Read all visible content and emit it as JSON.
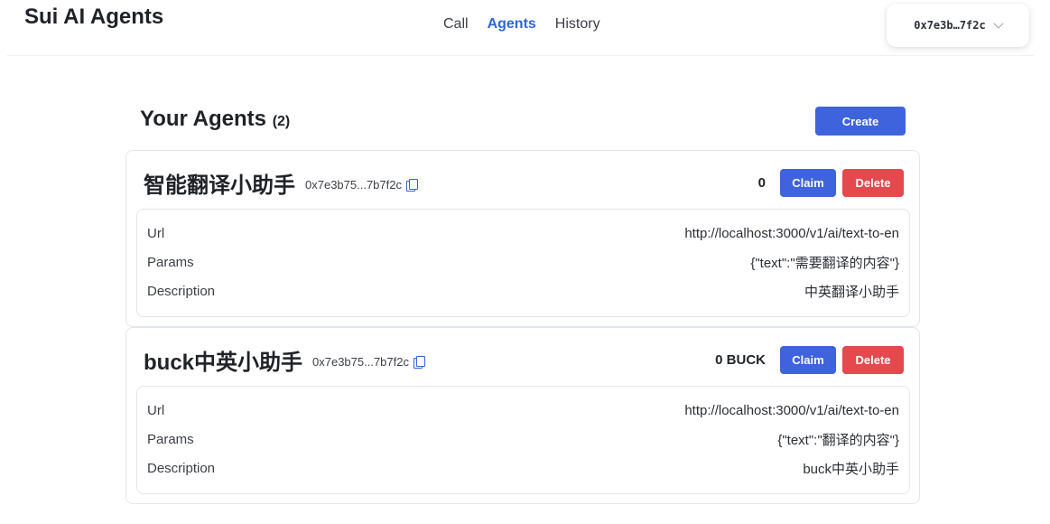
{
  "app": {
    "title": "Sui AI Agents"
  },
  "nav": {
    "call": "Call",
    "agents": "Agents",
    "history": "History"
  },
  "wallet": {
    "address": "0x7e3b…7f2c"
  },
  "page": {
    "heading": "Your Agents",
    "count": "(2)",
    "create_label": "Create"
  },
  "agents": [
    {
      "name": "智能翻译小助手",
      "address": "0x7e3b75...7b7f2c",
      "balance": "0",
      "claim_label": "Claim",
      "delete_label": "Delete",
      "url_label": "Url",
      "url": "http://localhost:3000/v1/ai/text-to-en",
      "params_label": "Params",
      "params": "{\"text\":\"需要翻译的内容\"}",
      "description_label": "Description",
      "description": "中英翻译小助手"
    },
    {
      "name": "buck中英小助手",
      "address": "0x7e3b75...7b7f2c",
      "balance": "0 BUCK",
      "claim_label": "Claim",
      "delete_label": "Delete",
      "url_label": "Url",
      "url": "http://localhost:3000/v1/ai/text-to-en",
      "params_label": "Params",
      "params": "{\"text\":\"翻译的内容\"}",
      "description_label": "Description",
      "description": "buck中英小助手"
    }
  ],
  "colors": {
    "accent": "#3e63dd",
    "danger": "#e5484d",
    "link_active": "#2f66d9"
  }
}
